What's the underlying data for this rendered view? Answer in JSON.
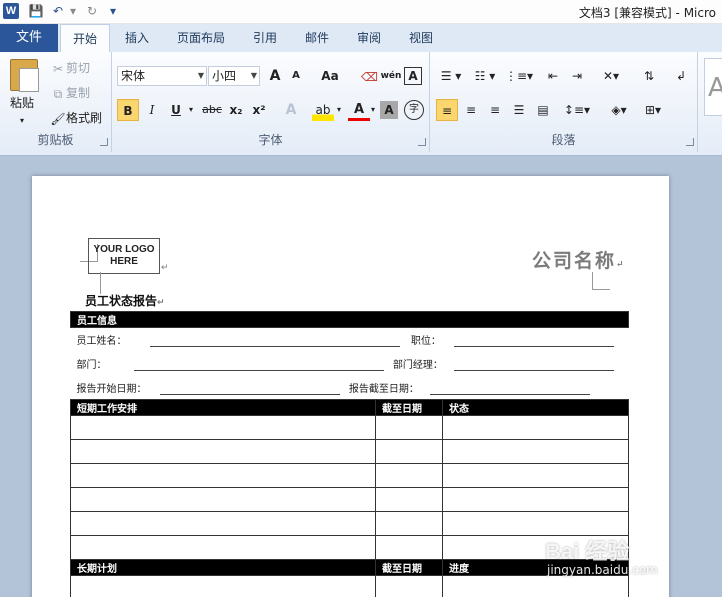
{
  "window": {
    "title": "文档3 [兼容模式] - Micro",
    "app_icon_letter": "W"
  },
  "qat": {
    "save": "💾",
    "undo": "↶",
    "redo": "↻",
    "customize": "▾"
  },
  "tabs": {
    "file": "文件",
    "items": [
      "开始",
      "插入",
      "页面布局",
      "引用",
      "邮件",
      "审阅",
      "视图"
    ]
  },
  "ribbon": {
    "clipboard": {
      "label": "剪贴板",
      "paste": "粘贴",
      "cut": "剪切",
      "copy": "复制",
      "format_painter": "格式刷"
    },
    "font": {
      "label": "字体",
      "font_name": "宋体",
      "font_size": "小四",
      "grow": "A",
      "shrink": "A",
      "case": "Aa",
      "clear": "ᴬ",
      "phonetic": "wén",
      "border_char": "A",
      "bold": "B",
      "italic": "I",
      "underline": "U",
      "strike": "abc",
      "subscript": "x₂",
      "superscript": "x²",
      "effects": "A",
      "highlight": "ab",
      "font_color": "A",
      "char_shading": "A",
      "enclose": "字"
    },
    "paragraph": {
      "label": "段落"
    }
  },
  "document": {
    "logo_text_1": "YOUR LOGO",
    "logo_text_2": "HERE",
    "company_name": "公司名称",
    "title": "员工状态报告",
    "section1": "员工信息",
    "name_label": "员工姓名：",
    "position_label": "职位：",
    "dept_label": "部门：",
    "manager_label": "部门经理：",
    "start_date_label": "报告开始日期：",
    "end_date_label": "报告截至日期：",
    "section2": "短期工作安排",
    "deadline_label": "截至日期",
    "status_label": "状态",
    "section3": "长期计划",
    "deadline_label_2": "截至日期",
    "progress_label": "进度"
  },
  "watermark": {
    "brand": "Bai 经验",
    "url": "jingyan.baidu.com"
  }
}
